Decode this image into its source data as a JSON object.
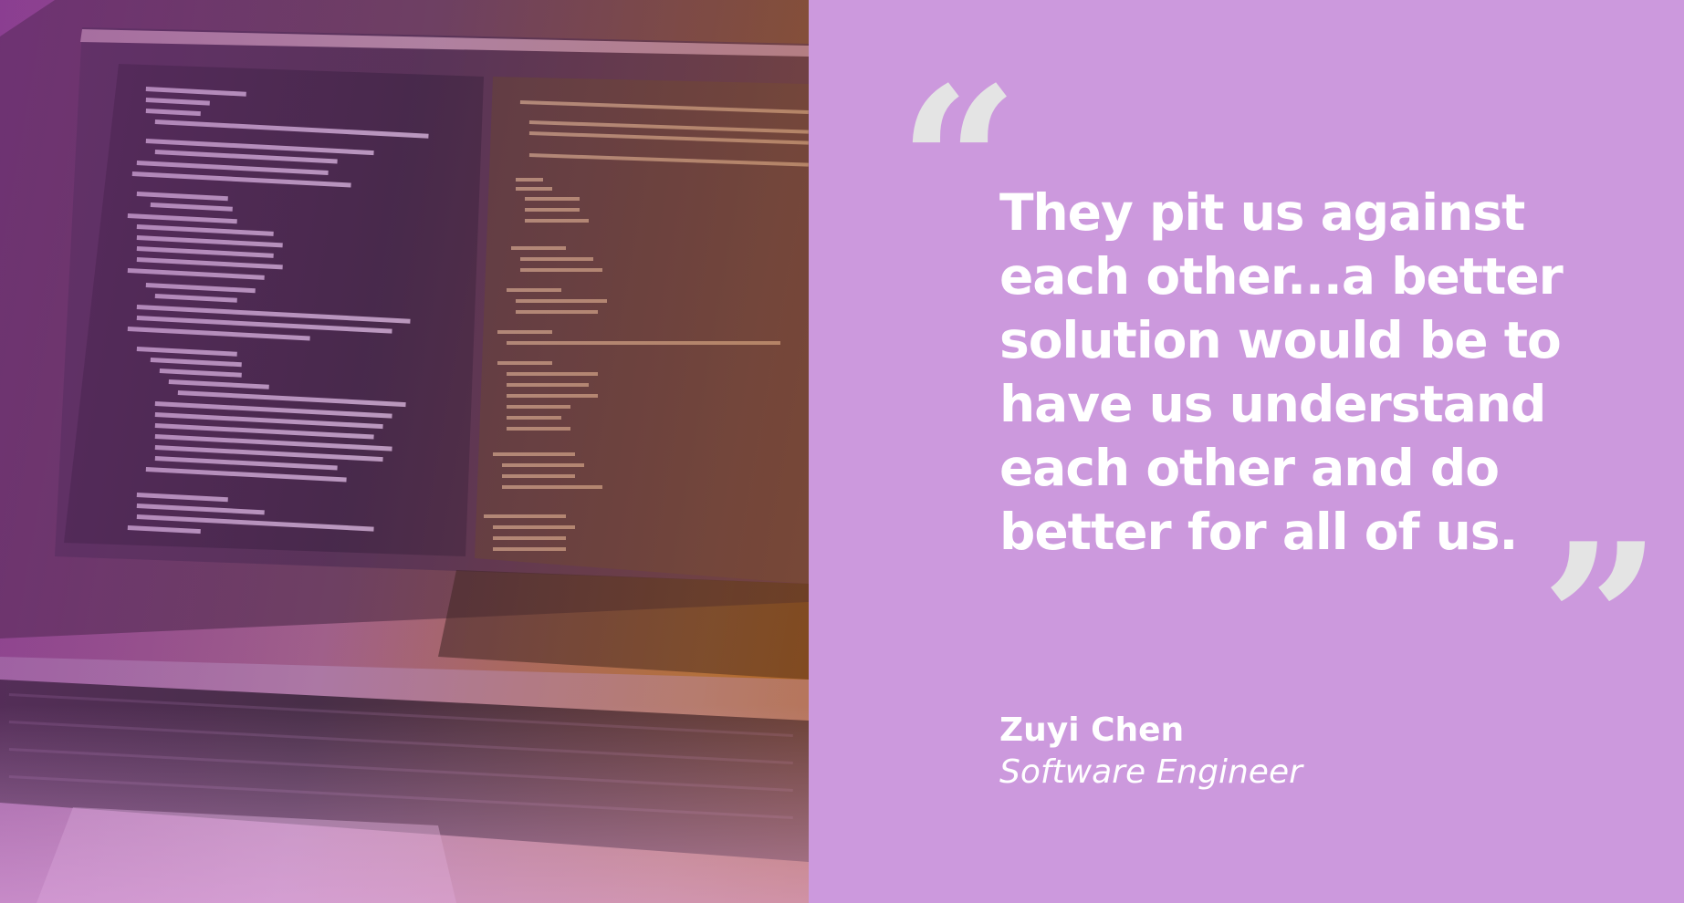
{
  "quote": {
    "text": "They pit us against each other...a better solution would be to have us understand each other and do better for all of us.",
    "open_mark": "“",
    "close_mark": "”"
  },
  "author": {
    "name": "Zuyi Chen",
    "title": "Software Engineer"
  },
  "colors": {
    "background": "#cc99dd",
    "quote_text": "#ffffff",
    "quote_marks": "#e4e4e4"
  },
  "photo": {
    "description_icon": "laptop-code-editor-photo"
  }
}
